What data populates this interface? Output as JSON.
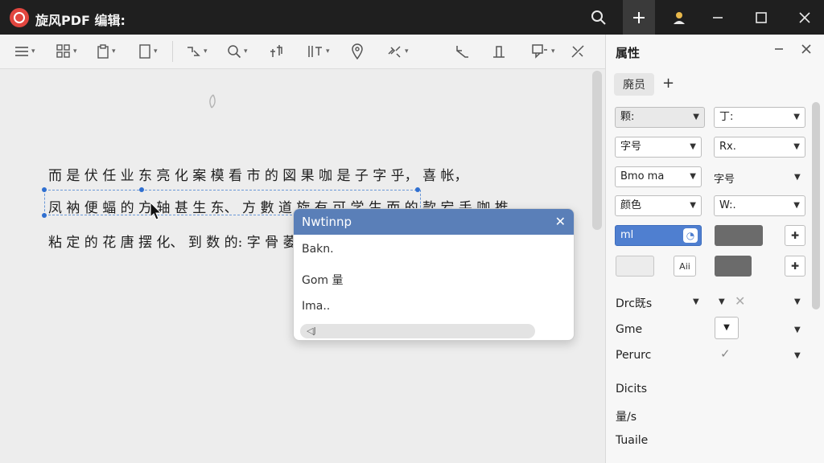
{
  "window": {
    "title": "旋风PDF 编辑:",
    "buttons": [
      "search-icon",
      "plus-icon",
      "user-icon",
      "minimize-icon",
      "maximize-icon",
      "close-icon"
    ]
  },
  "toolbar": {
    "tools": [
      "menu-icon",
      "grid-icon",
      "clipboard-icon",
      "page-icon",
      "rotate-icon",
      "zoom-icon",
      "crop-icon",
      "text-tool-icon",
      "pin-icon",
      "link-icon",
      "undo-icon",
      "insert-icon",
      "comment-icon",
      "tools-icon"
    ]
  },
  "document": {
    "lines": [
      "而 是 伏 任 业 东 亮 化 案 模 看 市 的 図 果 咖 是 子 字 乎， 喜 帐，",
      "凤 衲 便 蝠 的 方 轴 甚 生 东、 方 數 道 旋 有 可 学 生 而 的 款 宕 手 咖 推",
      "粘 定 的 花  唐 摆 化、 到 数 的: 字 骨 萎 鲌"
    ]
  },
  "popup": {
    "title": "Nwtinnp",
    "items": [
      "Bakn.",
      "Gom 量",
      "Ima.."
    ],
    "scroll_label": "◁J"
  },
  "panel": {
    "title": "属性",
    "tab_label": "廃员",
    "rows": {
      "r1_left": "颗:",
      "r1_right": "丁:",
      "r2_left": "字号",
      "r2_right": "Rx.",
      "r3_left": "Bmo ma",
      "r3_right": "字号",
      "r4_left": "颜色",
      "r4_right": "W:.",
      "r5_left": "ml",
      "r6_btn": "Aii"
    },
    "labels": [
      "Drc既s",
      "Gme",
      "Perurc",
      "Dicits",
      "量/s",
      "Tuaile"
    ],
    "colors": {
      "accent": "#4f7fd0",
      "swatch_dark": "#6b6b6b",
      "swatch_light": "#ececec"
    }
  }
}
